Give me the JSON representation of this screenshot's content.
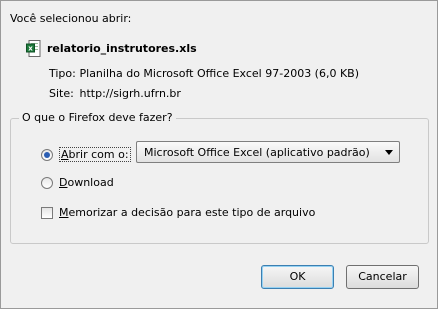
{
  "header": {
    "label": "Você selecionou abrir:"
  },
  "file": {
    "name": "relatorio_instrutores.xls",
    "icon": "excel-file-icon"
  },
  "meta": {
    "type_key": "Tipo:",
    "type_value": "Planilha do Microsoft Office Excel 97-2003 (6,0 KB)",
    "site_key": "Site:",
    "site_value": "http://sigrh.ufrn.br"
  },
  "action_group": {
    "legend": "O que o Firefox deve fazer?",
    "open_with_label_pre": "A",
    "open_with_label_post": "brir com o:",
    "open_with_selected": "Microsoft Office Excel (aplicativo padrão)",
    "download_label_pre": "D",
    "download_label_post": "ownload",
    "remember_label_pre": "M",
    "remember_label_post": "emorizar a decisão para este tipo de arquivo",
    "open_with_checked": true,
    "remember_checked": false
  },
  "buttons": {
    "ok": "OK",
    "cancel": "Cancelar"
  },
  "colors": {
    "radio_dot": "#2b5eb3",
    "excel_green": "#1d7a3a"
  }
}
